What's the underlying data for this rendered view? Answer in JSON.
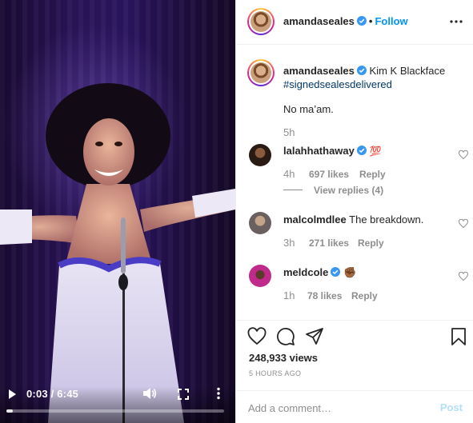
{
  "video": {
    "time": "0:03 / 6:45",
    "progress_fraction": 0.0074,
    "icons": [
      "play-icon",
      "volume-icon",
      "fullscreen-icon",
      "more-vertical-icon"
    ]
  },
  "header": {
    "username": "amandaseales",
    "separator": "•",
    "follow_label": "Follow",
    "more_icon": "more-horizontal-icon"
  },
  "caption": {
    "username": "amandaseales",
    "text": "Kim K Blackface",
    "hashtag": "#signedsealesdelivered",
    "body": "No ma’am.",
    "time": "5h"
  },
  "comments": [
    {
      "username": "lalahhathaway",
      "text": "💯",
      "time": "4h",
      "likes": "697 likes",
      "reply_label": "Reply",
      "view_replies": "View replies (4)"
    },
    {
      "username": "malcolmdlee",
      "text": "The breakdown.",
      "time": "3h",
      "likes": "271 likes",
      "reply_label": "Reply"
    },
    {
      "username": "meldcole",
      "text": "✊🏾",
      "time": "1h",
      "likes": "78 likes",
      "reply_label": "Reply"
    }
  ],
  "actions": {
    "icons": [
      "heart-icon",
      "comment-icon",
      "share-icon",
      "bookmark-icon"
    ],
    "views": "248,933 views",
    "time_ago": "5 HOURS AGO"
  },
  "add_comment": {
    "placeholder": "Add a comment…",
    "post_label": "Post"
  },
  "colors": {
    "link_blue": "#0095f6",
    "post_disabled": "#b2dffc",
    "hashtag": "#00376b",
    "verified": "#3897f0",
    "muted": "#8e8e8e"
  }
}
